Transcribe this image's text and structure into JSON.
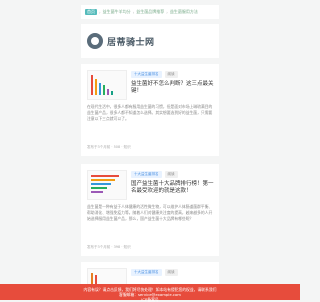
{
  "breadcrumb": {
    "home": "首页",
    "items": [
      "益生菌牛羊均分",
      "益生菌品牌推荐",
      "益生菌服用方法"
    ]
  },
  "brand": {
    "name": "居蒂骑士网"
  },
  "posts": [
    {
      "category": "十大益生菌排名",
      "read": "阅读",
      "title": "益生菌好不怎么判断？这三点最关键！",
      "excerpt": "在现代生活中，很多人都有服用益生菌的习惯，但是面对市场上琳琅满目的益生菌产品，很多人都不知道怎么选择。其实想要选到好的益生菌，只需要注意以下三点就可以了。",
      "meta": "发布于3个月前 · 508 · 知识"
    },
    {
      "category": "十大益生菌排名",
      "read": "阅读",
      "title": "国产益生菌十大品牌排行榜！第一名最受欢迎的就是这款！",
      "excerpt": "益生菌是一种有益于人体健康的活性微生物，可以维护人体肠道菌群平衡、帮助消化、增强免疫力等。随着人们对健康关注度的提高，越来越多的人开始选择服用益生菌产品，那么，国产益生菌十大品牌有哪些呢？",
      "meta": "发布于3个月前 · 398 · 知识"
    },
    {
      "category": "十大益生菌排名",
      "read": "阅读"
    }
  ],
  "footer": {
    "line1": "内容有误？请点击反馈，我们将尽快处理！如本站有侵犯您的权益，请联系我们",
    "line2": "客服邮箱：service@example.com",
    "line3": "ICP备案号"
  },
  "colors": {
    "footer_bg": "#e74c3c",
    "tag_bg": "#e8f2ff"
  }
}
